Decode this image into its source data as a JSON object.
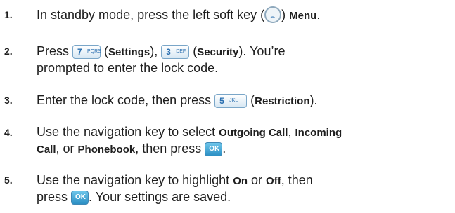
{
  "steps": [
    {
      "number": "1.",
      "p1": "In standby mode, press the left soft key (",
      "p2": ") ",
      "menu": "Menu",
      "p3": "."
    },
    {
      "number": "2.",
      "p1": "Press ",
      "key7": {
        "num": "7",
        "letters": "PQRS"
      },
      "p2": " (",
      "settings": "Settings",
      "p3": "), ",
      "key3": {
        "num": "3",
        "letters": "DEF"
      },
      "p4": " (",
      "security": "Security",
      "p5": "). You’re",
      "line2": "prompted to enter the lock code."
    },
    {
      "number": "3.",
      "p1": "Enter the lock code, then press ",
      "key5": {
        "num": "5",
        "letters": "JKL"
      },
      "p2": " (",
      "restriction": "Restriction",
      "p3": ")."
    },
    {
      "number": "4.",
      "p1": "Use the navigation key to select ",
      "outgoing": "Outgoing Call",
      "p2": ", ",
      "incoming": "Incoming",
      "call": "Call",
      "p3": ", or ",
      "phonebook": "Phonebook",
      "p4": ", then press ",
      "ok": "OK",
      "p5": "."
    },
    {
      "number": "5.",
      "p1": "Use the navigation key to highlight ",
      "on": "On",
      "p2": " or ",
      "off": "Off",
      "p3": ", then",
      "press": "press ",
      "ok": "OK",
      "p4": ". Your settings are saved."
    }
  ],
  "colors": {
    "text": "#1e1e1e",
    "key_text": "#2a6fb0",
    "ok_key": "#2c8fc4"
  },
  "icons": [
    "soft-key-icon",
    "key-7-icon",
    "key-3-icon",
    "key-5-icon",
    "ok-key-icon"
  ]
}
